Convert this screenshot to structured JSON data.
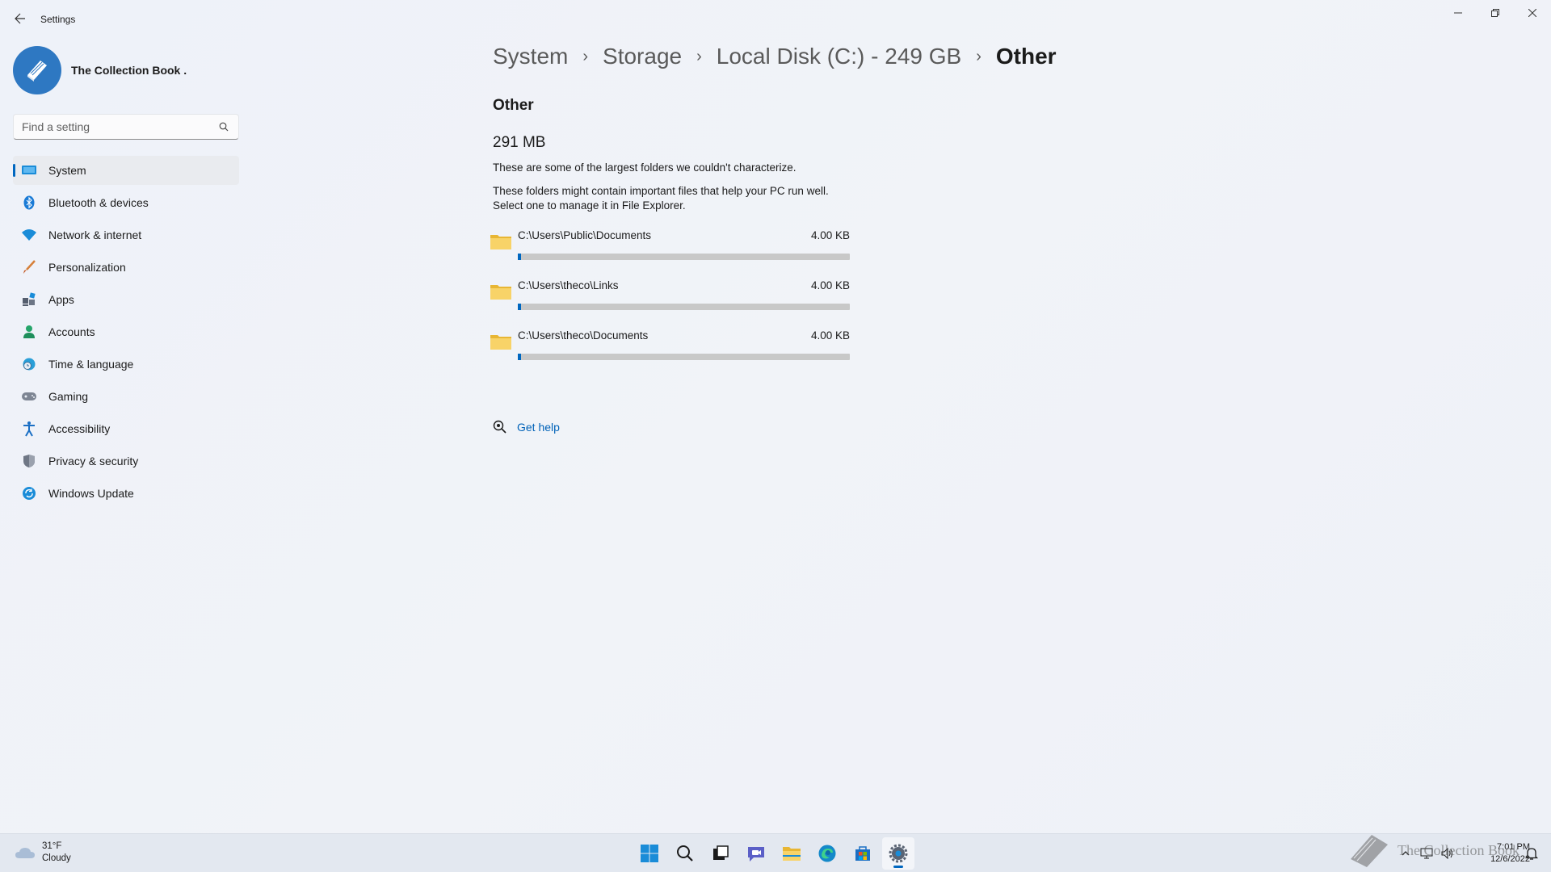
{
  "window": {
    "title": "Settings",
    "controls": [
      "minimize",
      "restore",
      "close"
    ]
  },
  "profile": {
    "name": "The Collection Book ."
  },
  "search": {
    "placeholder": "Find a setting"
  },
  "sidebar": {
    "items": [
      {
        "label": "System",
        "icon": "monitor-icon",
        "active": true
      },
      {
        "label": "Bluetooth & devices",
        "icon": "bluetooth-icon"
      },
      {
        "label": "Network & internet",
        "icon": "wifi-icon"
      },
      {
        "label": "Personalization",
        "icon": "brush-icon"
      },
      {
        "label": "Apps",
        "icon": "apps-icon"
      },
      {
        "label": "Accounts",
        "icon": "person-icon"
      },
      {
        "label": "Time & language",
        "icon": "globe-clock-icon"
      },
      {
        "label": "Gaming",
        "icon": "gamepad-icon"
      },
      {
        "label": "Accessibility",
        "icon": "accessibility-icon"
      },
      {
        "label": "Privacy & security",
        "icon": "shield-icon"
      },
      {
        "label": "Windows Update",
        "icon": "update-icon"
      }
    ]
  },
  "breadcrumb": {
    "items": [
      "System",
      "Storage",
      "Local Disk (C:) - 249 GB",
      "Other"
    ]
  },
  "main": {
    "section_title": "Other",
    "total_size": "291 MB",
    "description_1": "These are some of the largest folders we couldn't characterize.",
    "description_2a": "These folders might contain important files that help your PC run well.",
    "description_2b": "Select one to manage it in File Explorer.",
    "folders": [
      {
        "path": "C:\\Users\\Public\\Documents",
        "size": "4.00 KB",
        "usage_fraction": 0.01
      },
      {
        "path": "C:\\Users\\theco\\Links",
        "size": "4.00 KB",
        "usage_fraction": 0.01
      },
      {
        "path": "C:\\Users\\theco\\Documents",
        "size": "4.00 KB",
        "usage_fraction": 0.01
      }
    ],
    "get_help": "Get help"
  },
  "taskbar": {
    "weather_temp": "31°F",
    "weather_desc": "Cloudy",
    "apps": [
      "start-icon",
      "search-icon",
      "task-view-icon",
      "chat-icon",
      "file-explorer-icon",
      "edge-icon",
      "store-icon",
      "settings-icon"
    ],
    "time": "7:01 PM",
    "date": "12/6/2022"
  },
  "watermark": {
    "text": "The Collection Book"
  },
  "colors": {
    "accent": "#0067c0",
    "link": "#0062b8",
    "folder": "#f5c542"
  }
}
